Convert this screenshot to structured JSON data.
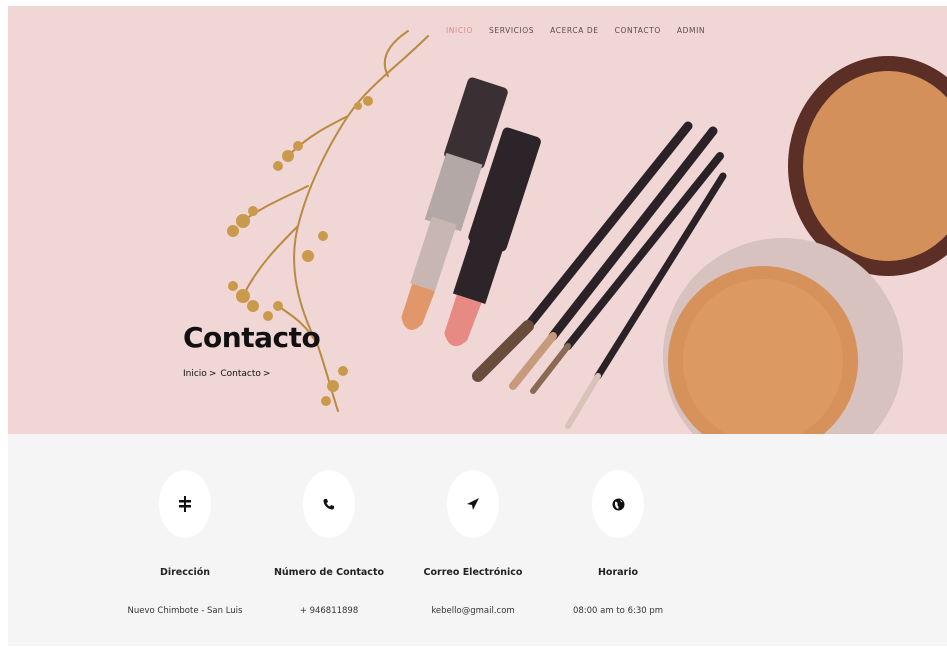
{
  "nav": {
    "items": [
      {
        "label": "INICIO",
        "active": true
      },
      {
        "label": "SERVICIOS",
        "active": false
      },
      {
        "label": "ACERCA DE",
        "active": false
      },
      {
        "label": "CONTACTO",
        "active": false
      },
      {
        "label": "ADMIN",
        "active": false
      }
    ]
  },
  "hero": {
    "title": "Contacto",
    "breadcrumb": [
      {
        "label": "Inicio",
        "sep": ">"
      },
      {
        "label": "Contacto",
        "sep": ">"
      }
    ]
  },
  "info_cards": [
    {
      "icon": "signpost-icon",
      "title": "Dirección",
      "value": "Nuevo Chimbote - San Luis"
    },
    {
      "icon": "phone-icon",
      "title": "Número de Contacto",
      "value": "+ 946811898"
    },
    {
      "icon": "paper-plane-icon",
      "title": "Correo Electrónico",
      "value": "kebello@gmail.com"
    },
    {
      "icon": "globe-icon",
      "title": "Horario",
      "value": "08:00 am to 6:30 pm"
    }
  ],
  "colors": {
    "hero_bg": "#f1d6d6",
    "nav_active": "#e08a8a",
    "info_bg": "#f6f5f5"
  }
}
